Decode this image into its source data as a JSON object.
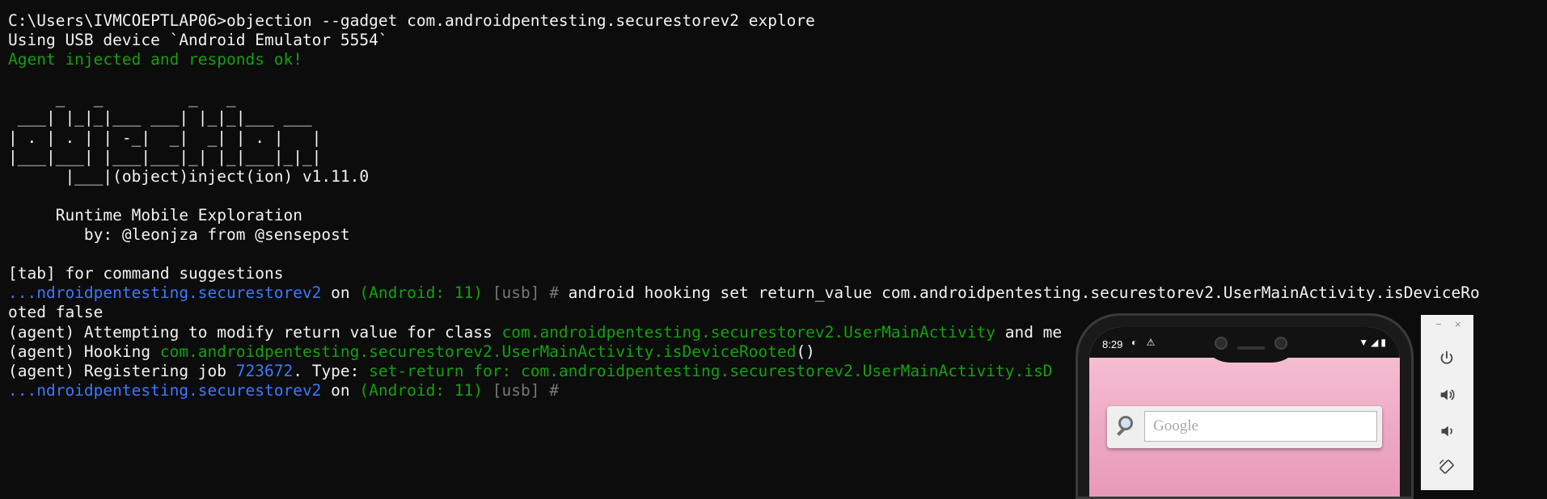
{
  "terminal": {
    "lines": [
      {
        "segments": [
          {
            "text": "C:\\Users\\IVMCOEPTLAP06>objection --gadget com.androidpentesting.securestorev2 explore",
            "color": "white"
          }
        ]
      },
      {
        "segments": [
          {
            "text": "Using USB device `Android Emulator 5554`",
            "color": "white"
          }
        ]
      },
      {
        "segments": [
          {
            "text": "Agent injected and responds ok!",
            "color": "green"
          }
        ]
      },
      {
        "segments": [
          {
            "text": "",
            "color": "white"
          }
        ]
      },
      {
        "segments": [
          {
            "text": "     _   _         _   _",
            "color": "white"
          }
        ]
      },
      {
        "segments": [
          {
            "text": " ___| |_|_|___ ___| |_|_|___ ___",
            "color": "white"
          }
        ]
      },
      {
        "segments": [
          {
            "text": "| . | . | | -_|  _|  _| | . |   |",
            "color": "white"
          }
        ]
      },
      {
        "segments": [
          {
            "text": "|___|___| |___|___|_| |_|___|_|_|",
            "color": "white"
          }
        ]
      },
      {
        "segments": [
          {
            "text": "      |___|(object)inject(ion) v1.11.0",
            "color": "white"
          }
        ]
      },
      {
        "segments": [
          {
            "text": "",
            "color": "white"
          }
        ]
      },
      {
        "segments": [
          {
            "text": "     Runtime Mobile Exploration",
            "color": "white"
          }
        ]
      },
      {
        "segments": [
          {
            "text": "        by: @leonjza from @sensepost",
            "color": "white"
          }
        ]
      },
      {
        "segments": [
          {
            "text": "",
            "color": "white"
          }
        ]
      },
      {
        "segments": [
          {
            "text": "[tab] for command suggestions",
            "color": "white"
          }
        ]
      },
      {
        "segments": [
          {
            "text": "...ndroidpentesting.securestorev2",
            "color": "blue"
          },
          {
            "text": " on ",
            "color": "white"
          },
          {
            "text": "(Android: 11)",
            "color": "green"
          },
          {
            "text": " [usb] #",
            "color": "gray"
          },
          {
            "text": " android hooking set return_value com.androidpentesting.securestorev2.UserMainActivity.isDeviceRo",
            "color": "white"
          }
        ]
      },
      {
        "segments": [
          {
            "text": "oted false",
            "color": "white"
          }
        ]
      },
      {
        "segments": [
          {
            "text": "(agent) Attempting to modify return value for class ",
            "color": "white"
          },
          {
            "text": "com.androidpentesting.securestorev2.UserMainActivity",
            "color": "green"
          },
          {
            "text": " and me",
            "color": "white"
          }
        ]
      },
      {
        "segments": [
          {
            "text": "(agent) Hooking ",
            "color": "white"
          },
          {
            "text": "com.androidpentesting.securestorev2.UserMainActivity",
            "color": "green"
          },
          {
            "text": ".isDeviceRooted",
            "color": "green"
          },
          {
            "text": "()",
            "color": "white"
          }
        ]
      },
      {
        "segments": [
          {
            "text": "(agent) Registering job ",
            "color": "white"
          },
          {
            "text": "723672",
            "color": "blue"
          },
          {
            "text": ". Type: ",
            "color": "white"
          },
          {
            "text": "set-return for: com.androidpentesting.securestorev2.UserMainActivity.isD",
            "color": "green"
          }
        ]
      },
      {
        "segments": [
          {
            "text": "...ndroidpentesting.securestorev2",
            "color": "blue"
          },
          {
            "text": " on ",
            "color": "white"
          },
          {
            "text": "(Android: 11)",
            "color": "green"
          },
          {
            "text": " [usb] #",
            "color": "gray"
          }
        ]
      }
    ]
  },
  "emulator": {
    "status_time": "8:29",
    "status_left_icons": "◐ ⚠",
    "status_right_icons": "▼◢▮",
    "search_placeholder": "Google"
  },
  "controls": {
    "minimize": "−",
    "close": "×",
    "buttons": [
      "power",
      "volume-up",
      "volume-down",
      "rotate"
    ]
  }
}
